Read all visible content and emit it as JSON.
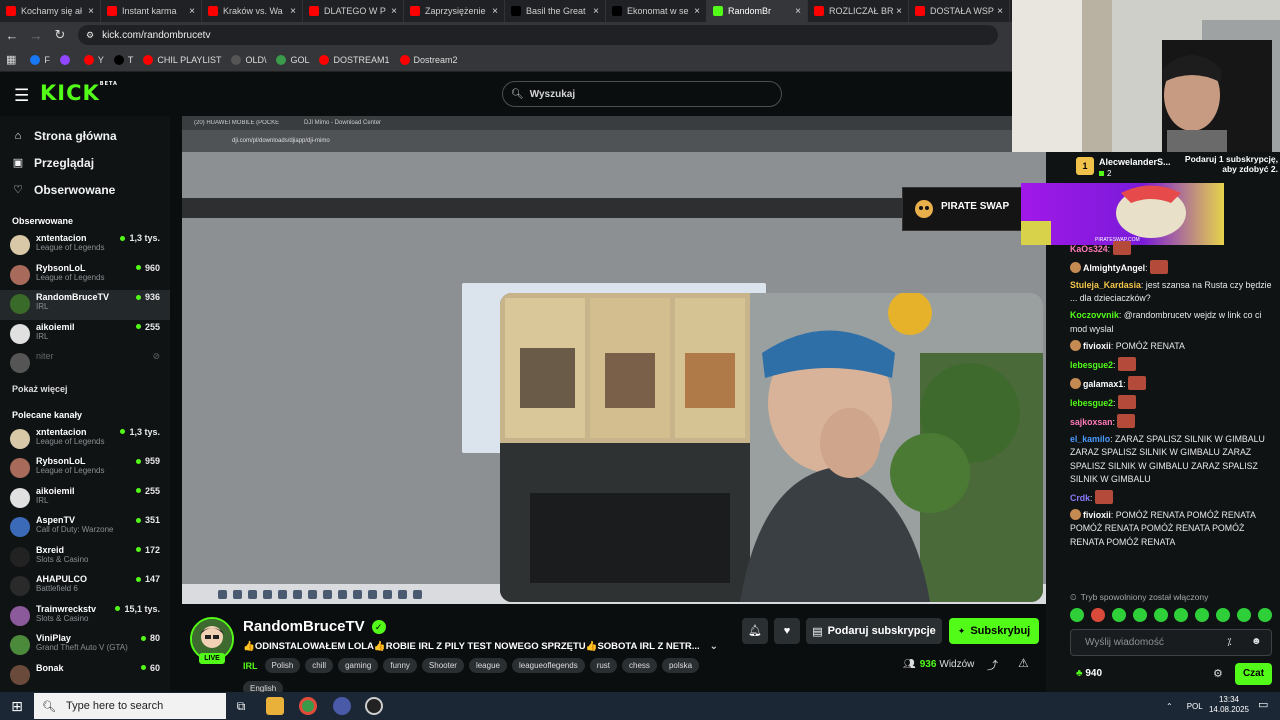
{
  "browser": {
    "tabs": [
      {
        "label": "Kochamy się ał",
        "icon": "youtube-icon",
        "color": "#ff0000"
      },
      {
        "label": "Instant karma",
        "icon": "youtube-icon",
        "color": "#ff0000"
      },
      {
        "label": "Kraków vs. Wa",
        "icon": "youtube-icon",
        "color": "#ff0000"
      },
      {
        "label": "DLATEGO W P",
        "icon": "youtube-icon",
        "color": "#ff0000"
      },
      {
        "label": "Zaprzysiężenie",
        "icon": "youtube-icon",
        "color": "#ff0000"
      },
      {
        "label": "Basil the Great",
        "icon": "x-icon",
        "color": "#000000"
      },
      {
        "label": "Ekonomat w se",
        "icon": "x-icon",
        "color": "#000000"
      },
      {
        "label": "RandomBr",
        "icon": "kick-icon",
        "color": "#53fc18",
        "active": true
      },
      {
        "label": "ROZLICZAŁ BR",
        "icon": "youtube-icon",
        "color": "#ff0000"
      },
      {
        "label": "DOSTAŁA WSP",
        "icon": "youtube-icon",
        "color": "#ff0000"
      }
    ],
    "url": "kick.com/randombrucetv",
    "bookmarks": [
      {
        "label": "F",
        "color": "#1877f2"
      },
      {
        "label": "",
        "color": "#9146ff"
      },
      {
        "label": "Y",
        "color": "#ff0000"
      },
      {
        "label": "T",
        "color": "#000000"
      },
      {
        "label": "CHIL PLAYLIST",
        "color": "#ff0000"
      },
      {
        "label": "OLD\\",
        "color": "#555555"
      },
      {
        "label": "GOL",
        "color": "#3a9a4a"
      },
      {
        "label": "DOSTREAM1",
        "color": "#ff0000"
      },
      {
        "label": "Dostream2",
        "color": "#ff0000"
      }
    ]
  },
  "header": {
    "logo": "KICK",
    "logo_sup": "BETA",
    "search_placeholder": "Wyszukaj"
  },
  "sidebar": {
    "nav": [
      {
        "label": "Strona główna",
        "icon": "home-icon",
        "glyph": "⌂"
      },
      {
        "label": "Przeglądaj",
        "icon": "browse-icon",
        "glyph": "▣"
      },
      {
        "label": "Obserwowane",
        "icon": "heart-icon",
        "glyph": "♡"
      }
    ],
    "following_title": "Obserwowane",
    "following": [
      {
        "name": "xntentacion",
        "game": "League of Legends",
        "viewers": "1,3 tys.",
        "color": "#d8c8a8"
      },
      {
        "name": "RybsonLoL",
        "game": "League of Legends",
        "viewers": "960",
        "color": "#a86a5a"
      },
      {
        "name": "RandomBruceTV",
        "game": "IRL",
        "viewers": "936",
        "color": "#3a6a2a",
        "selected": true
      },
      {
        "name": "aikoiemil",
        "game": "IRL",
        "viewers": "255",
        "color": "#e0e0e0"
      },
      {
        "name": "niter",
        "game": "",
        "viewers": "",
        "color": "#555555",
        "offline": true
      }
    ],
    "show_more": "Pokaż więcej",
    "recommended_title": "Polecane kanały",
    "recommended": [
      {
        "name": "xntentacion",
        "game": "League of Legends",
        "viewers": "1,3 tys.",
        "color": "#d8c8a8"
      },
      {
        "name": "RybsonLoL",
        "game": "League of Legends",
        "viewers": "959",
        "color": "#a86a5a"
      },
      {
        "name": "aikoiemil",
        "game": "IRL",
        "viewers": "255",
        "color": "#e0e0e0"
      },
      {
        "name": "AspenTV",
        "game": "Call of Duty: Warzone",
        "viewers": "351",
        "color": "#3a6ab8"
      },
      {
        "name": "Bxreid",
        "game": "Slots & Casino",
        "viewers": "172",
        "color": "#222222"
      },
      {
        "name": "AHAPULCO",
        "game": "Battlefield 6",
        "viewers": "147",
        "color": "#2a2a2a"
      },
      {
        "name": "Trainwreckstv",
        "game": "Slots & Casino",
        "viewers": "15,1 tys.",
        "color": "#8a5a9a"
      },
      {
        "name": "ViniPlay",
        "game": "Grand Theft Auto V (GTA)",
        "viewers": "80",
        "color": "#4a8a3a"
      },
      {
        "name": "Bonak",
        "game": "",
        "viewers": "60",
        "color": "#6a4a3a"
      }
    ]
  },
  "stream": {
    "name": "RandomBruceTV",
    "live": "LIVE",
    "title": "👍ODINSTALOWAŁEM LOLA👍ROBIE IRL Z PILY TEST NOWEGO SPRZĘTU👍SOBOTA IRL Z NETR...",
    "category": "IRL",
    "tags": [
      "Polish",
      "chill",
      "gaming",
      "funny",
      "Shooter",
      "league",
      "leagueoflegends",
      "rust",
      "chess",
      "polska"
    ],
    "tags_row2": [
      "English"
    ],
    "gift_button": "Podaruj subskrypcje",
    "subscribe_button": "Subskrybuj",
    "viewers": "936",
    "viewers_label": "Widzów"
  },
  "screenshare": {
    "tabs": [
      "(20) HUAWEI MOBILE (POCKE",
      "DJI Mimo - Download Center"
    ],
    "url": "dji.com/pl/downloads/djiapp/dji-mimo"
  },
  "chat": {
    "gifter_name": "AlecwelanderS...",
    "gifter_count": "2",
    "gifter_rank": "1",
    "gift_cta": "Podaruj 1 subskrypcję, aby zdobyć 2.",
    "ad_left": "PIRATE SWAP",
    "ad_url": "PIRATESWAP.COM",
    "messages": [
      {
        "user": "KaOs324",
        "color": "#ff7ab8",
        "text": "",
        "emote": true,
        "badge": false
      },
      {
        "user": "AlmightyAngel",
        "color": "#ffffff",
        "text": "",
        "emote": true,
        "badge": true
      },
      {
        "user": "Stuleja_Kardasia",
        "color": "#f3c54a",
        "text": "jest szansa na Rusta czy będzie ... dla dzieciaczków?",
        "emote": false,
        "badge": false
      },
      {
        "user": "Koczovvnik",
        "color": "#53fc18",
        "text": "@randombrucetv wejdz w link co ci mod wyslal",
        "emote": false,
        "badge": false
      },
      {
        "user": "fivioxii",
        "color": "#ffffff",
        "text": "POMÓŻ RENATA",
        "emote": false,
        "badge": true
      },
      {
        "user": "lebesgue2",
        "color": "#53fc18",
        "text": "",
        "emote": true,
        "badge": false
      },
      {
        "user": "galamax1",
        "color": "#ffffff",
        "text": "",
        "emote": true,
        "badge": true
      },
      {
        "user": "lebesgue2",
        "color": "#53fc18",
        "text": "",
        "emote": true,
        "badge": false
      },
      {
        "user": "sajkoxsan",
        "color": "#ff7ab8",
        "text": "",
        "emote": true,
        "badge": false
      },
      {
        "user": "el_kamilo",
        "color": "#4a9aff",
        "text": "ZARAZ SPALISZ SILNIK W GIMBALU ZARAZ SPALISZ SILNIK W GIMBALU ZARAZ SPALISZ SILNIK W GIMBALU ZARAZ SPALISZ SILNIK W GIMBALU",
        "emote": false,
        "badge": false
      },
      {
        "user": "Crdk",
        "color": "#8a7aff",
        "text": "",
        "emote": true,
        "badge": false
      },
      {
        "user": "fivioxii",
        "color": "#ffffff",
        "text": "POMÓŻ RENATA POMÓŻ RENATA POMÓŻ RENATA POMÓŻ RENATA POMÓŻ RENATA POMÓŻ RENATA",
        "emote": false,
        "badge": true
      }
    ],
    "slow_mode": "Tryb spowolniony został włączony",
    "input_placeholder": "Wyślij wiadomość",
    "points": "940",
    "send_button": "Czat"
  },
  "taskbar": {
    "search_placeholder": "Type here to search",
    "lang": "POL",
    "time": "13:34",
    "date": "14.08.2025"
  }
}
